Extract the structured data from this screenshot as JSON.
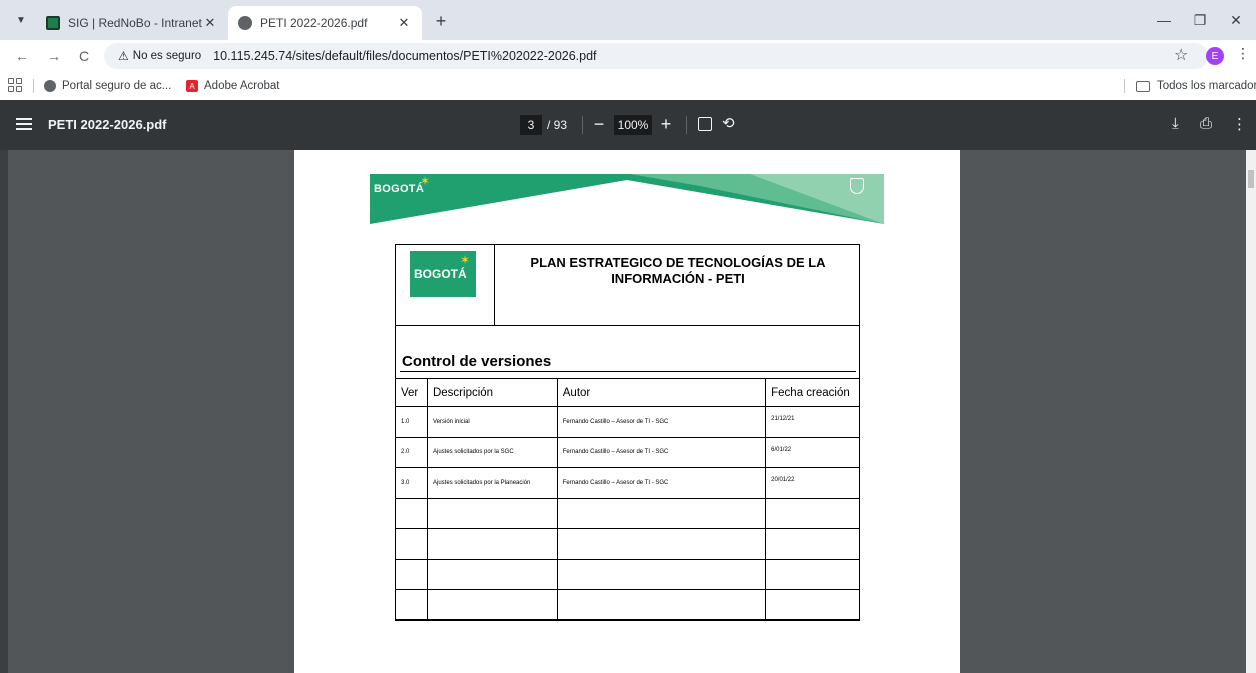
{
  "browser": {
    "tabs": [
      {
        "title": "SIG | RedNoBo - Intranet",
        "active": false
      },
      {
        "title": "PETI 2022-2026.pdf",
        "active": true
      }
    ],
    "security_label": "No es seguro",
    "url": "10.115.245.74/sites/default/files/documentos/PETI%202022-2026.pdf",
    "avatar_initial": "E",
    "bookmarks": [
      {
        "label": "Portal seguro de ac..."
      },
      {
        "label": "Adobe Acrobat"
      }
    ],
    "all_bookmarks_label": "Todos los marcadores"
  },
  "pdf_viewer": {
    "file_name": "PETI 2022-2026.pdf",
    "current_page": "3",
    "total_pages": "/ 93",
    "zoom": "100%"
  },
  "document": {
    "banner_logo": "BOGOTÁ",
    "logo_text": "BOGOTÁ",
    "title_line1": "PLAN ESTRATEGICO DE TECNOLOGÍAS DE LA",
    "title_line2": "INFORMACIÓN - PETI",
    "section_title": "Control de versiones",
    "table": {
      "headers": [
        "Ver",
        "Descripción",
        "Autor",
        "Fecha creación"
      ],
      "rows": [
        [
          "1.0",
          "Versión inicial",
          "Fernando Castillo – Asesor de TI - SGC",
          "21/12/21"
        ],
        [
          "2.0",
          "Ajustes solicitados por la SGC",
          "Fernando Castillo – Asesor de TI - SGC",
          "6/01/22"
        ],
        [
          "3.0",
          "Ajustes solicitados por la Planeación",
          "Fernando Castillo – Asesor de TI - SGC",
          "20/01/22"
        ],
        [
          "",
          "",
          "",
          ""
        ],
        [
          "",
          "",
          "",
          ""
        ],
        [
          "",
          "",
          "",
          ""
        ],
        [
          "",
          "",
          "",
          ""
        ]
      ]
    }
  },
  "colors": {
    "pdf_toolbar": "#323639",
    "viewer_bg": "#525659",
    "banner_green": "#1fa06e",
    "tabstrip": "#dee3ec"
  }
}
